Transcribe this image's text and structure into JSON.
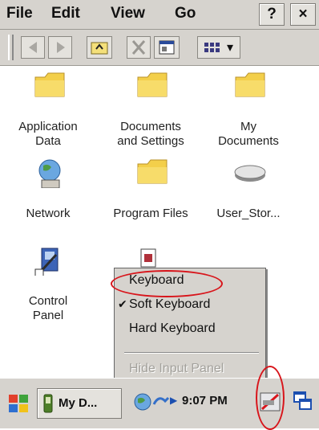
{
  "menubar": {
    "items": [
      "File",
      "Edit",
      "View",
      "Go"
    ],
    "help": "?",
    "close": "×"
  },
  "toolbar": {
    "view_dropdown_arrow": "▾"
  },
  "desktop": {
    "icons": [
      {
        "line1": "Application",
        "line2": "Data",
        "icon": "folder-icon"
      },
      {
        "line1": "Documents",
        "line2": "and Settings",
        "icon": "folder-icon"
      },
      {
        "line1": "My",
        "line2": "Documents",
        "icon": "folder-icon"
      },
      {
        "line1": "Network",
        "line2": "",
        "icon": "network-globe-icon"
      },
      {
        "line1": "Program Files",
        "line2": "",
        "icon": "folder-icon"
      },
      {
        "line1": "User_Stor...",
        "line2": "",
        "icon": "storage-drive-icon"
      },
      {
        "line1": "Control",
        "line2": "Panel",
        "icon": "control-panel-icon"
      }
    ]
  },
  "popup": {
    "items": [
      {
        "label": "Keyboard",
        "checked": false,
        "disabled": false
      },
      {
        "label": "Soft Keyboard",
        "checked": true,
        "disabled": false
      },
      {
        "label": "Hard Keyboard",
        "checked": false,
        "disabled": false
      },
      {
        "label": "Hide Input Panel",
        "checked": false,
        "disabled": true
      }
    ],
    "check_glyph": "✔"
  },
  "taskbar": {
    "window_button": "My D...",
    "clock": "9:07 PM"
  },
  "colors": {
    "annotation": "#d8151b",
    "chrome": "#d6d3ce"
  }
}
